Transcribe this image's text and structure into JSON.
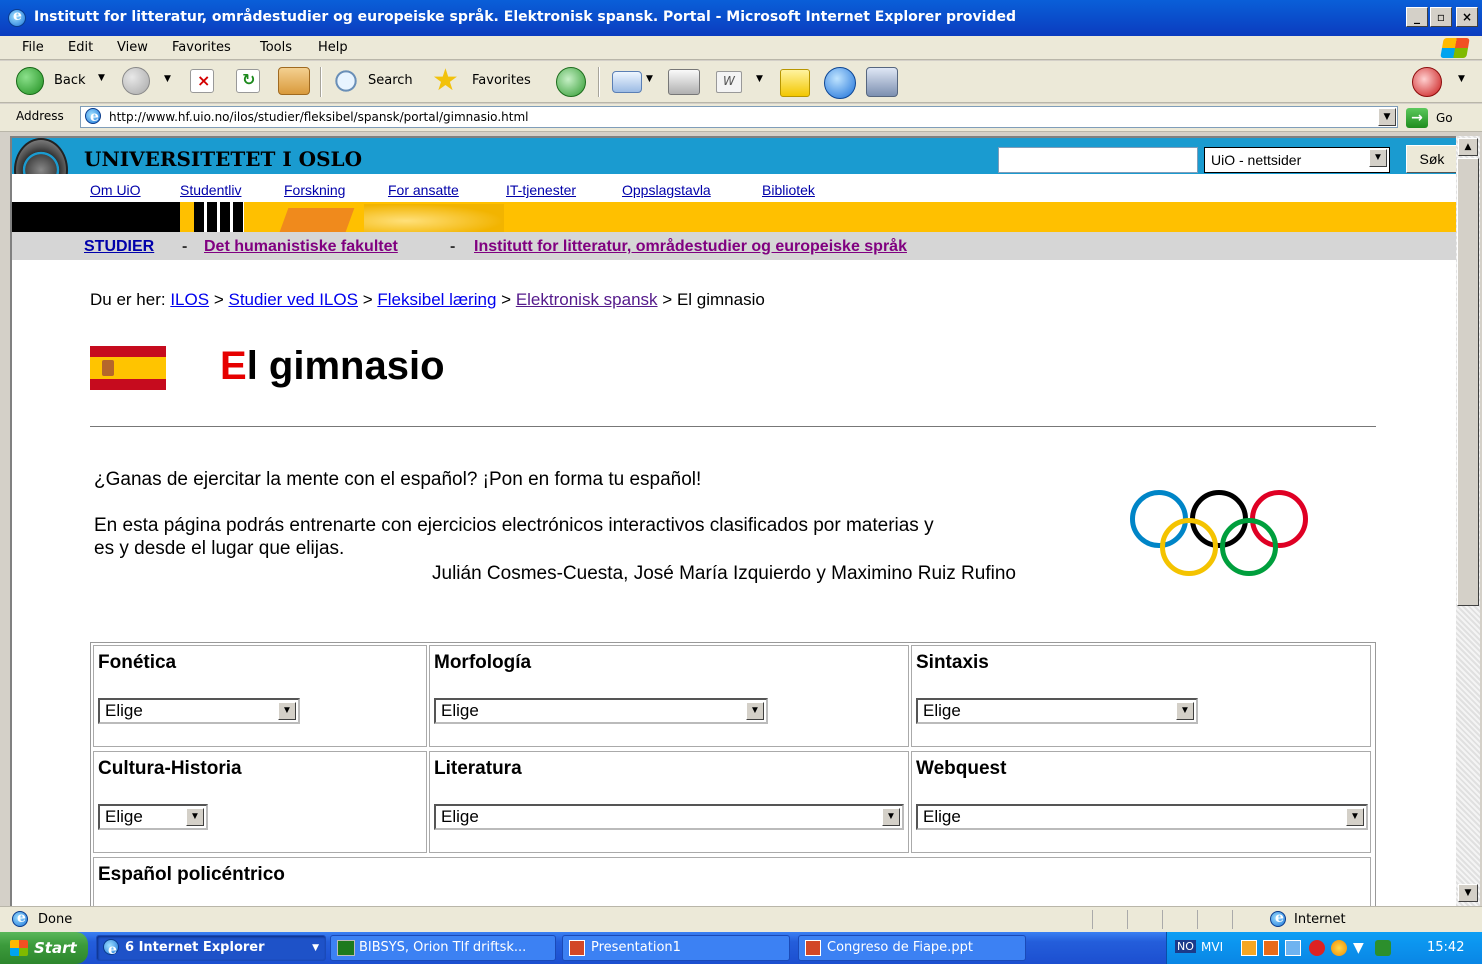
{
  "window": {
    "title": "Institutt for litteratur, områdestudier og europeiske språk. Elektronisk spansk. Portal - Microsoft Internet Explorer provided",
    "controls": [
      "_",
      "▫",
      "×"
    ]
  },
  "menu": [
    "File",
    "Edit",
    "View",
    "Favorites",
    "Tools",
    "Help"
  ],
  "toolbar": {
    "back": "Back",
    "search": "Search",
    "favorites": "Favorites"
  },
  "address": {
    "label": "Address",
    "url": "http://www.hf.uio.no/ilos/studier/fleksibel/spansk/portal/gimnasio.html",
    "go": "Go"
  },
  "site": {
    "title": "UNIVERSITETET I OSLO",
    "search_select": "UiO - nettsider",
    "search_button": "Søk",
    "nav": [
      "Om UiO",
      "Studentliv",
      "Forskning",
      "For ansatte",
      "IT-tjenester",
      "Oppslagstavla",
      "Bibliotek"
    ],
    "crumbs": {
      "c1": "STUDIER",
      "sep": "-",
      "c2": "Det humanistiske fakultet",
      "c3": "Institutt for litteratur, områdestudier og europeiske språk"
    }
  },
  "breadcrumb": {
    "prefix": "Du er her:",
    "l1": "ILOS",
    "l2": "Studier ved ILOS",
    "l3": "Fleksibel læring",
    "l4": "Elektronisk spansk",
    "sep": ">",
    "current": "El gimnasio"
  },
  "page": {
    "heading_first": "E",
    "heading_rest": "l gimnasio",
    "intro": "¿Ganas de ejercitar la mente con el español? ¡Pon en forma tu español!",
    "para_line1": "En esta página podrás entrenarte con ejercicios electrónicos interactivos clasificados por materias y",
    "para_line2": "es y desde el lugar que elijas.",
    "authors": "Julián Cosmes-Cuesta, José María Izquierdo y Maximino Ruiz Rufino"
  },
  "categories": [
    {
      "label": "Fonética",
      "selected": "Elige"
    },
    {
      "label": "Morfología",
      "selected": "Elige"
    },
    {
      "label": "Sintaxis",
      "selected": "Elige"
    },
    {
      "label": "Cultura-Historia",
      "selected": "Elige"
    },
    {
      "label": "Literatura",
      "selected": "Elige"
    },
    {
      "label": "Webquest",
      "selected": "Elige"
    },
    {
      "label": "Español policéntrico"
    }
  ],
  "status": {
    "text": "Done",
    "zone": "Internet"
  },
  "taskbar": {
    "start": "Start",
    "tasks": [
      "6 Internet Explorer",
      "BIBSYS, Orion Tlf driftsk...",
      "Presentation1",
      "Congreso de Fiape.ppt"
    ],
    "tray_labels": [
      "NO",
      "MVI"
    ],
    "clock": "15:42"
  },
  "colors": {
    "uio_blue": "#1a9bd0",
    "stripe_yellow": "#ffc000",
    "heading_accent": "#e60000"
  }
}
